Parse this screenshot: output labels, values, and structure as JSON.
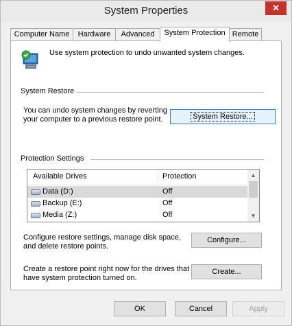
{
  "window": {
    "title": "System Properties",
    "close_glyph": "✕"
  },
  "tabs": [
    {
      "label": "Computer Name"
    },
    {
      "label": "Hardware"
    },
    {
      "label": "Advanced"
    },
    {
      "label": "System Protection",
      "active": true
    },
    {
      "label": "Remote"
    }
  ],
  "intro": {
    "text": "Use system protection to undo unwanted system changes.",
    "icon": "system-protection-icon"
  },
  "system_restore": {
    "heading": "System Restore",
    "description_line1": "You can undo system changes by reverting",
    "description_line2": "your computer to a previous restore point.",
    "button_label": "System Restore..."
  },
  "protection": {
    "heading": "Protection Settings",
    "columns": [
      "Available Drives",
      "Protection"
    ],
    "drives": [
      {
        "name": "Data (D:)",
        "protection": "Off",
        "selected": true
      },
      {
        "name": "Backup (E:)",
        "protection": "Off"
      },
      {
        "name": "Media (Z:)",
        "protection": "Off"
      }
    ],
    "configure_line1": "Configure restore settings, manage disk space,",
    "configure_line2": "and delete restore points.",
    "configure_label": "Configure...",
    "create_line1": "Create a restore point right now for the drives that",
    "create_line2": "have system protection turned on.",
    "create_label": "Create..."
  },
  "footer": {
    "ok": "OK",
    "cancel": "Cancel",
    "apply": "Apply"
  }
}
